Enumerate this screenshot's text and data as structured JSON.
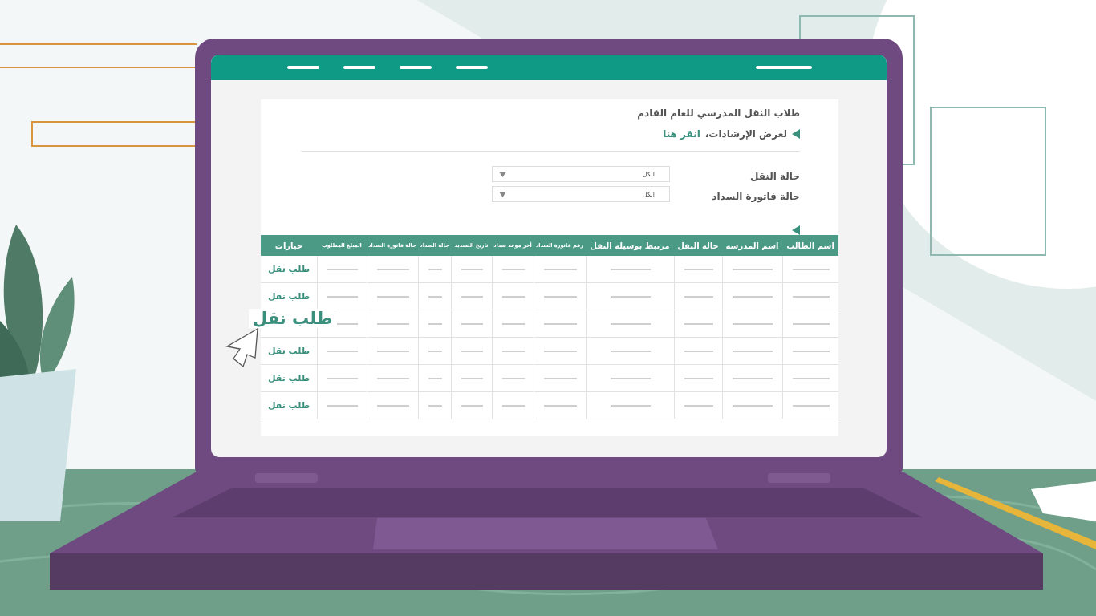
{
  "page": {
    "title": "طلاب النقل المدرسي للعام القادم",
    "instructions": {
      "text": "لعرض الإرشادات،",
      "link": "انقر هنا"
    }
  },
  "filters": [
    {
      "label": "حالة النقل",
      "value": "الكل"
    },
    {
      "label": "حالة فاتورة السداد",
      "value": "الكل"
    }
  ],
  "table": {
    "columns": [
      {
        "label": "اسم الطالب",
        "kind": "main"
      },
      {
        "label": "اسم المدرسة",
        "kind": "main"
      },
      {
        "label": "حالة النقل",
        "kind": "main"
      },
      {
        "label": "مرتبط بوسيلة النقل",
        "kind": "main"
      },
      {
        "label": "رقم فاتورة السداد",
        "kind": "minor"
      },
      {
        "label": "أخر موعد سداد",
        "kind": "minor"
      },
      {
        "label": "تاريخ التسديد",
        "kind": "minor"
      },
      {
        "label": "حالة السداد",
        "kind": "minor"
      },
      {
        "label": "حالة فاتورة السداد",
        "kind": "minor"
      },
      {
        "label": "المبلغ المطلوب",
        "kind": "minor"
      },
      {
        "label": "خيارات",
        "kind": "main"
      }
    ],
    "rows": [
      {
        "option": "طلب نقل",
        "highlighted": false
      },
      {
        "option": "طلب نقل",
        "highlighted": false
      },
      {
        "option": "طلب نقل",
        "highlighted": true
      },
      {
        "option": "طلب نقل",
        "highlighted": false
      },
      {
        "option": "طلب نقل",
        "highlighted": false
      },
      {
        "option": "طلب نقل",
        "highlighted": false
      }
    ]
  }
}
